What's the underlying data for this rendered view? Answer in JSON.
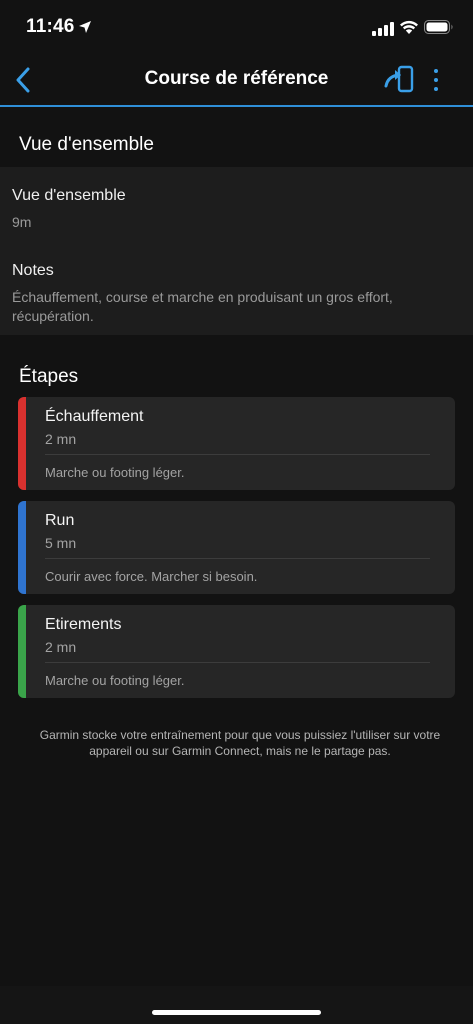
{
  "status_bar": {
    "time": "11:46"
  },
  "header": {
    "title": "Course de référence"
  },
  "overview_section": {
    "heading": "Vue d'ensemble",
    "fields": [
      {
        "label": "Vue d'ensemble",
        "value": "9m"
      },
      {
        "label": "Notes",
        "value": "Échauffement, course et marche en produisant un gros effort, récupération."
      }
    ]
  },
  "steps_section": {
    "heading": "Étapes",
    "steps": [
      {
        "name": "Échauffement",
        "duration": "2 mn",
        "note": "Marche ou footing léger.",
        "color": "#d9312f"
      },
      {
        "name": "Run",
        "duration": "5 mn",
        "note": "Courir avec force. Marcher si besoin.",
        "color": "#2f74d0"
      },
      {
        "name": "Etirements",
        "duration": "2 mn",
        "note": "Marche ou footing léger.",
        "color": "#3aa44a"
      }
    ]
  },
  "footer": {
    "text": "Garmin stocke votre entraînement pour que vous puissiez l'utiliser sur votre appareil ou sur Garmin Connect, mais ne le partage pas."
  },
  "icons": {
    "accent": "#3a9fe8"
  }
}
